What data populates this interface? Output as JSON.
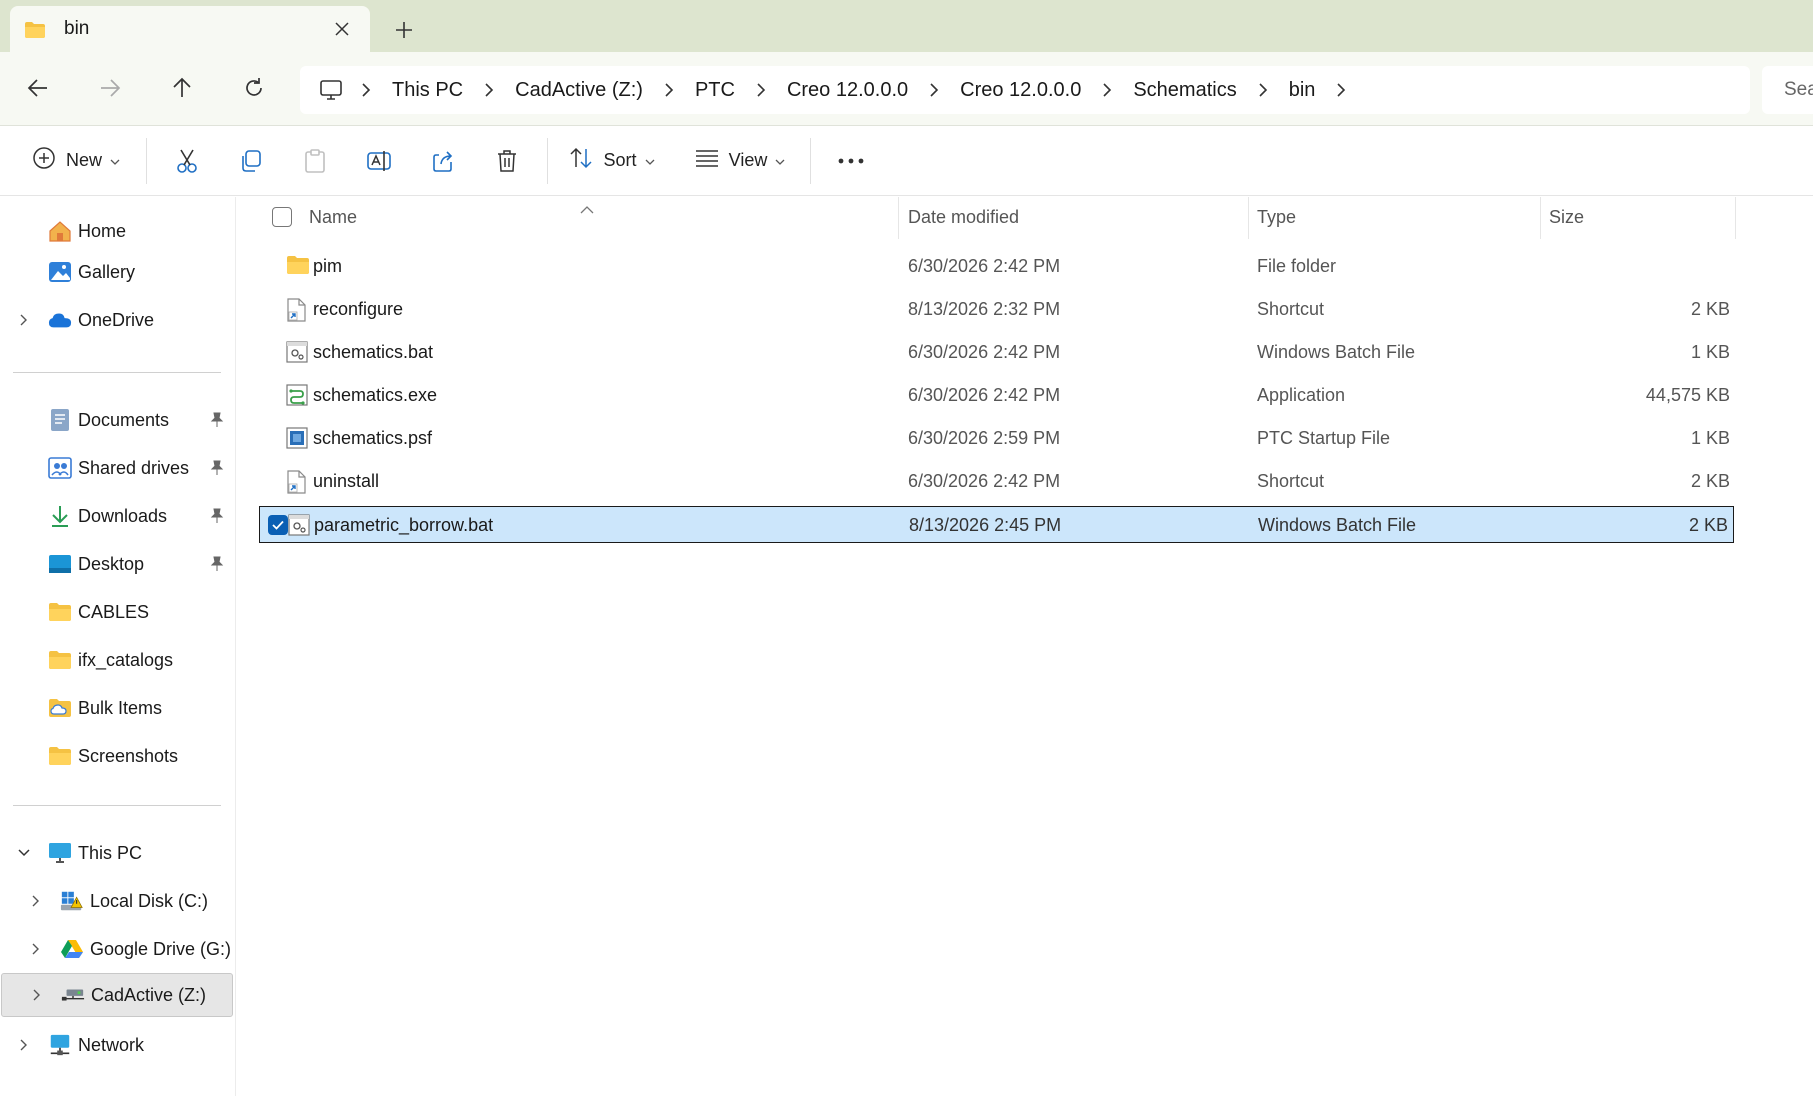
{
  "tab": {
    "title": "bin",
    "close_glyph": "✕",
    "new_tab_glyph": "+"
  },
  "address": {
    "breadcrumbs": [
      "This PC",
      "CadActive (Z:)",
      "PTC",
      "Creo 12.0.0.0",
      "Creo 12.0.0.0",
      "Schematics",
      "bin"
    ],
    "search_placeholder": "Sea"
  },
  "commands": {
    "new": "New",
    "sort": "Sort",
    "view": "View"
  },
  "sidebar": {
    "quick": [
      {
        "label": "Home",
        "icon": "home-icon"
      },
      {
        "label": "Gallery",
        "icon": "gallery-icon"
      },
      {
        "label": "OneDrive",
        "icon": "cloud-icon"
      }
    ],
    "pinned": [
      {
        "label": "Documents",
        "icon": "documents-icon",
        "pinned": true
      },
      {
        "label": "Shared drives",
        "icon": "shared-drives-icon",
        "pinned": true
      },
      {
        "label": "Downloads",
        "icon": "downloads-icon",
        "pinned": true
      },
      {
        "label": "Desktop",
        "icon": "desktop-icon",
        "pinned": true
      },
      {
        "label": "CABLES",
        "icon": "folder-icon",
        "pinned": false
      },
      {
        "label": "ifx_catalogs",
        "icon": "folder-icon",
        "pinned": false
      },
      {
        "label": "Bulk Items",
        "icon": "cloud-folder-icon",
        "pinned": false
      },
      {
        "label": "Screenshots",
        "icon": "folder-icon",
        "pinned": false
      }
    ],
    "this_pc": {
      "label": "This PC",
      "icon": "monitor-icon"
    },
    "drives": [
      {
        "label": "Local Disk (C:)",
        "icon": "windows-drive-icon"
      },
      {
        "label": "Google Drive (G:)",
        "icon": "google-drive-icon"
      },
      {
        "label": "CadActive (Z:)",
        "icon": "network-drive-icon",
        "selected": true
      }
    ],
    "network": {
      "label": "Network",
      "icon": "network-icon"
    }
  },
  "columns": {
    "name": "Name",
    "date": "Date modified",
    "type": "Type",
    "size": "Size"
  },
  "files": [
    {
      "name": "pim",
      "date": "6/30/2026 2:42 PM",
      "type": "File folder",
      "size": "",
      "icon": "folder-icon"
    },
    {
      "name": "reconfigure",
      "date": "8/13/2026 2:32 PM",
      "type": "Shortcut",
      "size": "2 KB",
      "icon": "shortcut-icon"
    },
    {
      "name": "schematics.bat",
      "date": "6/30/2026 2:42 PM",
      "type": "Windows Batch File",
      "size": "1 KB",
      "icon": "batch-file-icon"
    },
    {
      "name": "schematics.exe",
      "date": "6/30/2026 2:42 PM",
      "type": "Application",
      "size": "44,575 KB",
      "icon": "application-icon"
    },
    {
      "name": "schematics.psf",
      "date": "6/30/2026 2:59 PM",
      "type": "PTC Startup File",
      "size": "1 KB",
      "icon": "psf-file-icon"
    },
    {
      "name": "uninstall",
      "date": "6/30/2026 2:42 PM",
      "type": "Shortcut",
      "size": "2 KB",
      "icon": "shortcut-icon"
    },
    {
      "name": "parametric_borrow.bat",
      "date": "8/13/2026 2:45 PM",
      "type": "Windows Batch File",
      "size": "2 KB",
      "icon": "batch-file-icon",
      "selected": true
    }
  ],
  "colors": {
    "tab_strip": "#dde5cf",
    "nav_bg": "#f7f9f3",
    "selection": "#cce6fb",
    "accent": "#0067c0",
    "folder": "#f5c243"
  }
}
